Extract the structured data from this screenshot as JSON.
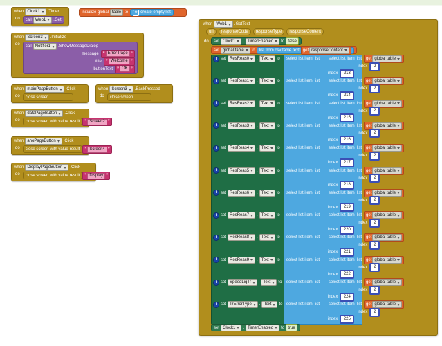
{
  "app": {
    "environment": "MIT App Inventor Blocks Editor",
    "canvas_background": "#ffffff",
    "colors": {
      "control_gold": "#b18e1d",
      "procedure_purple": "#8b5ea8",
      "variable_orange": "#e0652c",
      "component_green": "#1f6e45",
      "list_blue": "#4ea8e0",
      "text_pink": "#c7336f",
      "logic_olive": "#8fa83a",
      "math_navy": "#3b4fb5"
    }
  },
  "keywords": {
    "when": "when",
    "do": "do",
    "call": "call",
    "set": "set",
    "to": "to",
    "dot": ".",
    "index": "index",
    "list": "list",
    "text": "text",
    "result": "result",
    "quote": "”"
  },
  "blocks": {
    "clock_timer": {
      "name": "clock-timer-event",
      "when": "when",
      "component": "Clock1",
      "event": ".Timer",
      "do": "do",
      "call": "call",
      "call_component": "Web1",
      "call_method": ".Get"
    },
    "init_global_table": {
      "name": "init-global-table",
      "prefix": "initialize global",
      "variable": "table",
      "to": "to",
      "value_label": "create empty list"
    },
    "screen3_initialize": {
      "name": "screen3-initialize-event",
      "when": "when",
      "component": "Screen3",
      "event": ".Initialize",
      "do": "do",
      "call": "call",
      "call_component": "Notifier1",
      "call_method": ".ShowMessageDialog",
      "args": [
        {
          "label": "message",
          "value": "Error Page"
        },
        {
          "label": "title",
          "value": "Welcome"
        },
        {
          "label": "buttonText",
          "value": "OK"
        }
      ]
    },
    "main_page_button": {
      "name": "mainpagebutton-click-event",
      "when": "when",
      "component": "mainPageButton",
      "event": ".Click",
      "do": "do",
      "statement": "close screen"
    },
    "screen3_backpressed": {
      "name": "screen3-backpressed-event",
      "when": "when",
      "component": "Screen3",
      "event": ".BackPressed",
      "do": "do",
      "statement": "close screen"
    },
    "data_page_button": {
      "name": "datapagebutton-click-event",
      "when": "when",
      "component": "dataPageButton",
      "event": ".Click",
      "do": "do",
      "statement": "close screen with value",
      "result_label": "result",
      "result_value": "Screen2"
    },
    "ano_page_button": {
      "name": "anopagebutton-click-event",
      "when": "when",
      "component": "anoPageButton",
      "event": ".Click",
      "do": "do",
      "statement": "close screen with value",
      "result_label": "result",
      "result_value": "Screen4"
    },
    "display_page_button": {
      "name": "displaypagebutton-click-event",
      "when": "when",
      "component": "DisplayPageButton",
      "event": ".Click",
      "do": "do",
      "statement": "close screen with value",
      "result_label": "result",
      "result_value": "Display"
    },
    "web_gottext": {
      "name": "web1-gottext-event",
      "when": "when",
      "component": "Web1",
      "event": ".GotText",
      "params_keyword": "url",
      "params": [
        "responseCode",
        "responseType",
        "responseContent"
      ],
      "do": "do",
      "first_statement": {
        "set": "set",
        "component": "Clock1",
        "dot": ".",
        "property": "TimerEnabled",
        "to": "to",
        "value": "false"
      },
      "second_statement": {
        "set": "set",
        "variable": "global table",
        "to": "to",
        "fn": "list from csv table",
        "arg_label": "text",
        "get": "get",
        "get_var": "responseContent"
      },
      "last_statement": {
        "set": "set",
        "component": "Clock1",
        "dot": ".",
        "property": "TimerEnabled",
        "to": "to",
        "value": "true"
      },
      "assignments": [
        {
          "component": "ResReas0",
          "property": "Text",
          "outer_index": "213",
          "inner_index": "2"
        },
        {
          "component": "ResReas1",
          "property": "Text",
          "outer_index": "214",
          "inner_index": "2"
        },
        {
          "component": "ResReas2",
          "property": "Text",
          "outer_index": "215",
          "inner_index": "2"
        },
        {
          "component": "ResReas3",
          "property": "Text",
          "outer_index": "216",
          "inner_index": "2"
        },
        {
          "component": "ResReas4",
          "property": "Text",
          "outer_index": "217",
          "inner_index": "2"
        },
        {
          "component": "ResReas5",
          "property": "Text",
          "outer_index": "218",
          "inner_index": "2"
        },
        {
          "component": "ResReas6",
          "property": "Text",
          "outer_index": "219",
          "inner_index": "2"
        },
        {
          "component": "ResReas7",
          "property": "Text",
          "outer_index": "220",
          "inner_index": "2"
        },
        {
          "component": "ResReas8",
          "property": "Text",
          "outer_index": "221",
          "inner_index": "2"
        },
        {
          "component": "ResReas9",
          "property": "Text",
          "outer_index": "222",
          "inner_index": "2"
        },
        {
          "component": "SpeedLiqTf",
          "property": "Text",
          "outer_index": "224",
          "inner_index": "2"
        },
        {
          "component": "TrErrorType",
          "property": "Text",
          "outer_index": "225",
          "inner_index": "2"
        }
      ],
      "select_label": "select list item",
      "list_label": "list",
      "index_label": "index",
      "get_label": "get",
      "global_table_label": "global table"
    }
  }
}
